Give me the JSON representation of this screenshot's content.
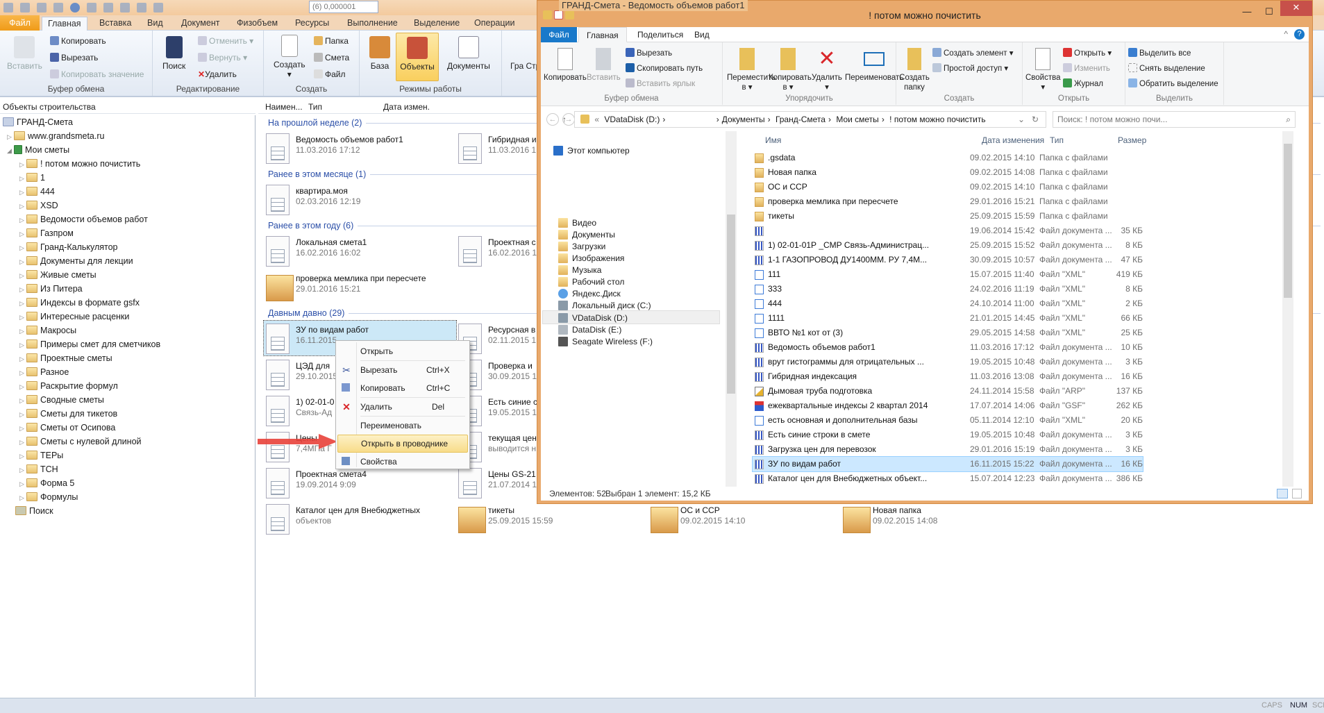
{
  "app": {
    "title": "ГРАНД-Смета - Ведомость объемов работ1",
    "precision_value": "(6) 0,000001",
    "tabs": [
      "Файл",
      "Главная",
      "Вставка",
      "Вид",
      "Документ",
      "Физобъем",
      "Ресурсы",
      "Выполнение",
      "Выделение",
      "Операции"
    ],
    "ribbon": {
      "clipboard": {
        "label": "Буфер обмена",
        "paste": "Вставить",
        "copy": "Копировать",
        "cut": "Вырезать",
        "copy_value": "Копировать значение"
      },
      "editing": {
        "label": "Редактирование",
        "search": "Поиск",
        "undo": "Отменить",
        "redo": "Вернуть",
        "delete": "Удалить"
      },
      "create": {
        "label": "Создать",
        "create": "Создать",
        "folder": "Папка",
        "estimate": "Смета",
        "file": "Файл"
      },
      "modes": {
        "label": "Режимы работы",
        "base": "База",
        "objects": "Объекты",
        "documents": "Документы"
      },
      "partial": "Гра Строй"
    },
    "status": {
      "caps": "CAPS",
      "num": "NUM",
      "scr": "SCR"
    }
  },
  "tree": {
    "header": "Объекты строительства",
    "root": "ГРАНД-Смета",
    "site": "www.grandsmeta.ru",
    "my": "Мои сметы",
    "items": [
      "! потом можно почистить",
      "1",
      "444",
      "XSD",
      "Ведомости объемов работ",
      "Газпром",
      "Гранд-Калькулятор",
      "Документы для лекции",
      "Живые сметы",
      "Из Питера",
      "Индексы в формате gsfx",
      "Интересные расценки",
      "Макросы",
      "Примеры смет для сметчиков",
      "Проектные сметы",
      "Разное",
      "Раскрытие формул",
      "Сводные сметы",
      "Сметы для тикетов",
      "Сметы от Осипова",
      "Сметы с нулевой длиной",
      "ТЕРы",
      "ТСН",
      "Форма 5",
      "Формулы"
    ],
    "search": "Поиск"
  },
  "middle": {
    "columns": [
      "Наимен...",
      "Тип",
      "Дата измен."
    ],
    "groups": [
      {
        "title": "На прошлой неделе (2)",
        "items": [
          {
            "name": "Ведомость объемов работ1",
            "date": "11.03.2016 17:12",
            "icon": "doc"
          },
          {
            "name": "Гибридная и",
            "date": "11.03.2016 1",
            "icon": "doc"
          }
        ]
      },
      {
        "title": "Ранее в этом месяце (1)",
        "items": [
          {
            "name": "квартира.моя",
            "date": "02.03.2016 12:19",
            "icon": "doc"
          }
        ]
      },
      {
        "title": "Ранее в этом году (6)",
        "items": [
          {
            "name": "Локальная смета1",
            "date": "16.02.2016 16:02",
            "icon": "doc"
          },
          {
            "name": "Проектная с",
            "date": "16.02.2016 1",
            "icon": "doc"
          },
          {
            "name": "проверка мемлика при пересчете",
            "date": "29.01.2016 15:21",
            "icon": "folder"
          }
        ]
      },
      {
        "title": "Давным давно (29)",
        "items": [
          {
            "name": "ЗУ по видам работ",
            "date": "16.11.2015",
            "icon": "doc"
          },
          {
            "name": "Ресурсная в",
            "date": "02.11.2015 1",
            "icon": "doc"
          },
          {
            "name": "ЦЭД для",
            "date": "29.10.2015",
            "icon": "doc"
          },
          {
            "name": "Проверка и",
            "date": "30.09.2015 1",
            "icon": "doc"
          },
          {
            "name": "1) 02-01-0",
            "date": "Связь-Ад",
            "icon": "doc"
          },
          {
            "name": "Есть синие с",
            "date": "19.05.2015 1",
            "icon": "doc"
          },
          {
            "name": "Цены",
            "date": "7,4МПа Г",
            "icon": "doc"
          },
          {
            "name": "текущая цен",
            "date": "выводится н",
            "icon": "doc"
          },
          {
            "name": "Проектная смета4",
            "date": "19.09.2014 9:09",
            "icon": "doc"
          },
          {
            "name": "Цены GS-21",
            "date": "21.07.2014 1",
            "icon": "doc"
          }
        ]
      }
    ],
    "last_row": [
      {
        "name": "Каталог цен для Внебюджетных",
        "date": "объектов",
        "icon": "doc"
      },
      {
        "name": "тикеты",
        "date": "25.09.2015 15:59",
        "icon": "folder"
      },
      {
        "name": "ОС и ССР",
        "date": "09.02.2015 14:10",
        "icon": "folder"
      },
      {
        "name": "Новая папка",
        "date": "09.02.2015 14:08",
        "icon": "folder"
      }
    ]
  },
  "context_menu": {
    "open": "Открыть",
    "cut": "Вырезать",
    "cut_sc": "Ctrl+X",
    "copy": "Копировать",
    "copy_sc": "Ctrl+C",
    "delete": "Удалить",
    "delete_sc": "Del",
    "rename": "Переименовать",
    "open_explorer": "Открыть в проводнике",
    "properties": "Свойства"
  },
  "explorer": {
    "title": "! потом можно почистить",
    "tabs": [
      "Файл",
      "Главная",
      "Поделиться",
      "Вид"
    ],
    "ribbon": {
      "clipboard": {
        "label": "Буфер обмена",
        "copy": "Копировать",
        "paste": "Вставить",
        "cut": "Вырезать",
        "copy_path": "Скопировать путь",
        "paste_shortcut": "Вставить ярлык"
      },
      "organize": {
        "label": "Упорядочить",
        "move": "Переместить в",
        "copy": "Копировать в",
        "delete": "Удалить",
        "rename": "Переименовать"
      },
      "new": {
        "label": "Создать",
        "new_folder": "Создать папку",
        "new_item": "Создать элемент",
        "easy_access": "Простой доступ"
      },
      "open": {
        "label": "Открыть",
        "properties": "Свойства",
        "open": "Открыть",
        "edit": "Изменить",
        "history": "Журнал"
      },
      "select": {
        "label": "Выделить",
        "all": "Выделить все",
        "none": "Снять выделение",
        "invert": "Обратить выделение"
      }
    },
    "address": [
      "VDataDisk (D:)",
      "Документы",
      "Гранд-Смета",
      "Мои сметы",
      "! потом можно почистить"
    ],
    "search_placeholder": "Поиск: ! потом можно почи...",
    "nav": {
      "this_pc": "Этот компьютер",
      "items": [
        "Видео",
        "Документы",
        "Загрузки",
        "Изображения",
        "Музыка",
        "Рабочий стол",
        "Яндекс.Диск",
        "Локальный диск (C:)",
        "VDataDisk (D:)",
        "DataDisk (E:)",
        "Seagate Wireless (F:)"
      ]
    },
    "columns": [
      "Имя",
      "Дата изменения",
      "Тип",
      "Размер"
    ],
    "files": [
      {
        "name": ".gsdata",
        "date": "09.02.2015 14:10",
        "type": "Папка с файлами",
        "size": "",
        "icon": "folder"
      },
      {
        "name": "Новая папка",
        "date": "09.02.2015 14:08",
        "type": "Папка с файлами",
        "size": "",
        "icon": "folder"
      },
      {
        "name": "ОС и ССР",
        "date": "09.02.2015 14:10",
        "type": "Папка с файлами",
        "size": "",
        "icon": "folder"
      },
      {
        "name": "проверка мемлика при пересчете",
        "date": "29.01.2016 15:21",
        "type": "Папка с файлами",
        "size": "",
        "icon": "folder"
      },
      {
        "name": "тикеты",
        "date": "25.09.2015 15:59",
        "type": "Папка с файлами",
        "size": "",
        "icon": "folder"
      },
      {
        "name": "",
        "date": "19.06.2014 15:42",
        "type": "Файл документа ...",
        "size": "35 КБ",
        "icon": "doc"
      },
      {
        "name": "1) 02-01-01Р _СМР Связь-Администрац...",
        "date": "25.09.2015 15:52",
        "type": "Файл документа ...",
        "size": "8 КБ",
        "icon": "doc"
      },
      {
        "name": "1-1 ГАЗОПРОВОД ДУ1400ММ. РУ 7,4М...",
        "date": "30.09.2015 10:57",
        "type": "Файл документа ...",
        "size": "47 КБ",
        "icon": "doc"
      },
      {
        "name": "111",
        "date": "15.07.2015 11:40",
        "type": "Файл \"XML\"",
        "size": "419 КБ",
        "icon": "xml"
      },
      {
        "name": "333",
        "date": "24.02.2016 11:19",
        "type": "Файл \"XML\"",
        "size": "8 КБ",
        "icon": "xml"
      },
      {
        "name": "444",
        "date": "24.10.2014 11:00",
        "type": "Файл \"XML\"",
        "size": "2 КБ",
        "icon": "xml"
      },
      {
        "name": "1111",
        "date": "21.01.2015 14:45",
        "type": "Файл \"XML\"",
        "size": "66 КБ",
        "icon": "xml"
      },
      {
        "name": "ВВТО №1 кот от (3)",
        "date": "29.05.2015 14:58",
        "type": "Файл \"XML\"",
        "size": "25 КБ",
        "icon": "xml"
      },
      {
        "name": "Ведомость объемов работ1",
        "date": "11.03.2016 17:12",
        "type": "Файл документа ...",
        "size": "10 КБ",
        "icon": "doc"
      },
      {
        "name": "врут гистограммы для отрицательных ...",
        "date": "19.05.2015 10:48",
        "type": "Файл документа ...",
        "size": "3 КБ",
        "icon": "doc"
      },
      {
        "name": "Гибридная индексация",
        "date": "11.03.2016 13:08",
        "type": "Файл документа ...",
        "size": "16 КБ",
        "icon": "doc"
      },
      {
        "name": "Дымовая труба подготовка",
        "date": "24.11.2014 15:58",
        "type": "Файл \"ARP\"",
        "size": "137 КБ",
        "icon": "arp"
      },
      {
        "name": "ежеквартальные индексы 2 квартал 2014",
        "date": "17.07.2014 14:06",
        "type": "Файл \"GSF\"",
        "size": "262 КБ",
        "icon": "gsf"
      },
      {
        "name": "есть основная и дополнительная базы",
        "date": "05.11.2014 12:10",
        "type": "Файл \"XML\"",
        "size": "20 КБ",
        "icon": "xml"
      },
      {
        "name": "Есть синие строки в смете",
        "date": "19.05.2015 10:48",
        "type": "Файл документа ...",
        "size": "3 КБ",
        "icon": "doc"
      },
      {
        "name": "Загрузка цен для перевозок",
        "date": "29.01.2016 15:19",
        "type": "Файл документа ...",
        "size": "3 КБ",
        "icon": "doc"
      },
      {
        "name": "ЗУ по видам работ",
        "date": "16.11.2015 15:22",
        "type": "Файл документа ...",
        "size": "16 КБ",
        "icon": "doc",
        "selected": true
      },
      {
        "name": "Каталог цен для Внебюджетных объект...",
        "date": "15.07.2014 12:23",
        "type": "Файл документа ...",
        "size": "386 КБ",
        "icon": "doc"
      }
    ],
    "status": {
      "count": "Элементов: 52",
      "selected": "Выбран 1 элемент: 15,2 КБ"
    }
  },
  "colors": {
    "explorer_frame": "#e9a96c",
    "file_tab": "#1979ca",
    "selection": "#cce8ff",
    "close": "#c7504a",
    "arrow": "#e8413a"
  }
}
